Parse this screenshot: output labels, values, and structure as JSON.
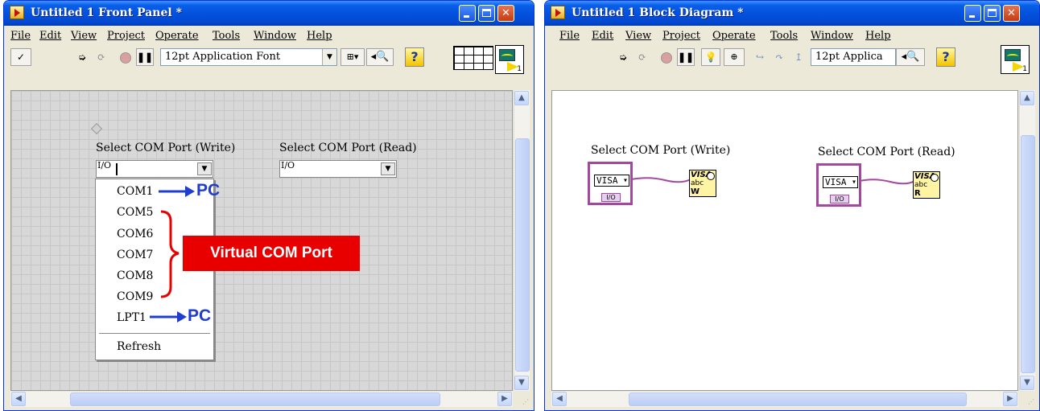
{
  "front_panel": {
    "title": "Untitled 1 Front Panel *",
    "menu": [
      "File",
      "Edit",
      "View",
      "Project",
      "Operate",
      "Tools",
      "Window",
      "Help"
    ],
    "font_select": "12pt Application Font",
    "connector_pane_number": "1",
    "controls": [
      {
        "label": "Select COM Port (Write)"
      },
      {
        "label": "Select COM Port (Read)"
      }
    ],
    "io_glyph": "I/O",
    "dropdown_items": [
      "COM1",
      "COM5",
      "COM6",
      "COM7",
      "COM8",
      "COM9",
      "LPT1"
    ],
    "dropdown_refresh": "Refresh",
    "annotations": {
      "pc_top": "PC",
      "pc_bottom": "PC",
      "virtual": "Virtual COM Port"
    }
  },
  "block_diagram": {
    "title": "Untitled 1 Block Diagram *",
    "menu": [
      "File",
      "Edit",
      "View",
      "Project",
      "Operate",
      "Tools",
      "Window",
      "Help"
    ],
    "font_select": "12pt Applica",
    "labels": [
      "Select COM Port (Write)",
      "Select COM Port (Read)"
    ],
    "visa_tag": "VISA",
    "io_tag": "I/O",
    "fn_write": {
      "t1": "VISA",
      "t2": "abc",
      "t3": "W"
    },
    "fn_read": {
      "t1": "VISA",
      "t2": "abc",
      "t3": "R"
    }
  },
  "icons": [
    "app-icon",
    "minimize-icon",
    "maximize-icon",
    "close-icon",
    "run-arrow-icon",
    "run-continuous-icon",
    "abort-icon",
    "pause-icon",
    "highlight-icon",
    "align-icon",
    "zoom-icon",
    "help-icon",
    "scroll-up-icon",
    "scroll-down-icon",
    "scroll-left-icon",
    "scroll-right-icon"
  ],
  "colors": {
    "title_bar": "#0350dd",
    "annotation_blue": "#1f3ecf",
    "annotation_red": "#e80000",
    "visa_border": "#a3489f",
    "wire": "#a3489f"
  }
}
